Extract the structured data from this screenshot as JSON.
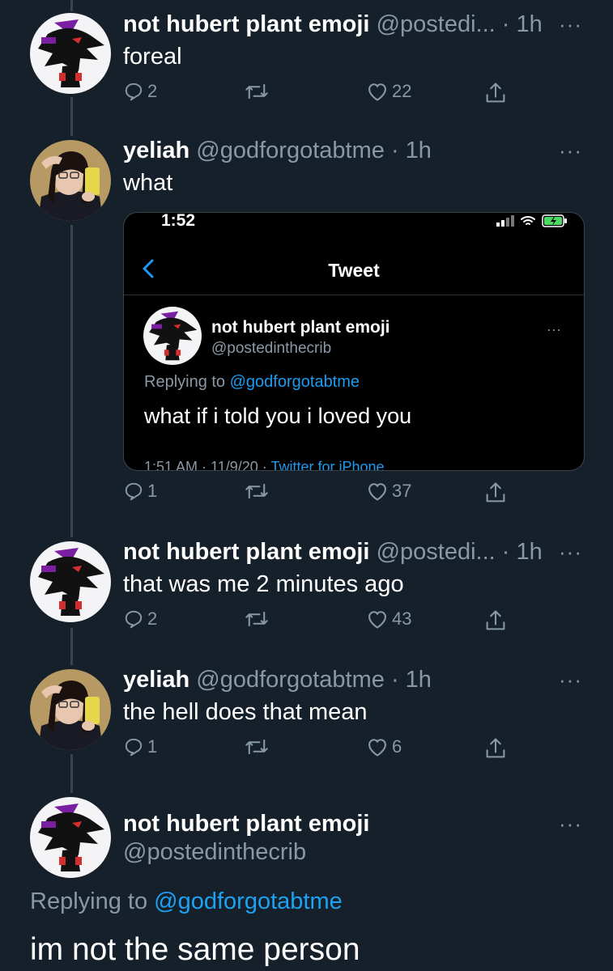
{
  "tweets": [
    {
      "name": "not hubert plant emoji",
      "handle": "@postedi...",
      "time": "· 1h",
      "text": "foreal",
      "replies": "2",
      "retweets": "",
      "likes": "22",
      "more": "···"
    },
    {
      "name": "yeliah",
      "handle": "@godforgotabtme",
      "time": "· 1h",
      "text": "what",
      "replies": "1",
      "retweets": "",
      "likes": "37",
      "more": "···"
    },
    {
      "name": "not hubert plant emoji",
      "handle": "@postedi...",
      "time": "· 1h",
      "text": "that was me 2 minutes ago",
      "replies": "2",
      "retweets": "",
      "likes": "43",
      "more": "···"
    },
    {
      "name": "yeliah",
      "handle": "@godforgotabtme",
      "time": "· 1h",
      "text": "the hell does that mean",
      "replies": "1",
      "retweets": "",
      "likes": "6",
      "more": "···"
    }
  ],
  "embed": {
    "status_time": "1:52",
    "title": "Tweet",
    "name": "not hubert plant emoji",
    "handle": "@postedinthecrib",
    "replying_prefix": "Replying to ",
    "replying_to": "@godforgotabtme",
    "text": "what if i told you i loved you",
    "meta_time": "1:51 AM · 11/9/20 · ",
    "meta_source": "Twitter for iPhone",
    "more": "···"
  },
  "focused": {
    "name": "not hubert plant emoji",
    "handle": "@postedinthecrib",
    "replying_prefix": "Replying to ",
    "replying_to": "@godforgotabtme",
    "text": "im not the same person",
    "more": "···"
  },
  "colors": {
    "background": "#15202b",
    "secondary": "#8899a6",
    "link": "#1da1f2",
    "line": "#38444d"
  }
}
